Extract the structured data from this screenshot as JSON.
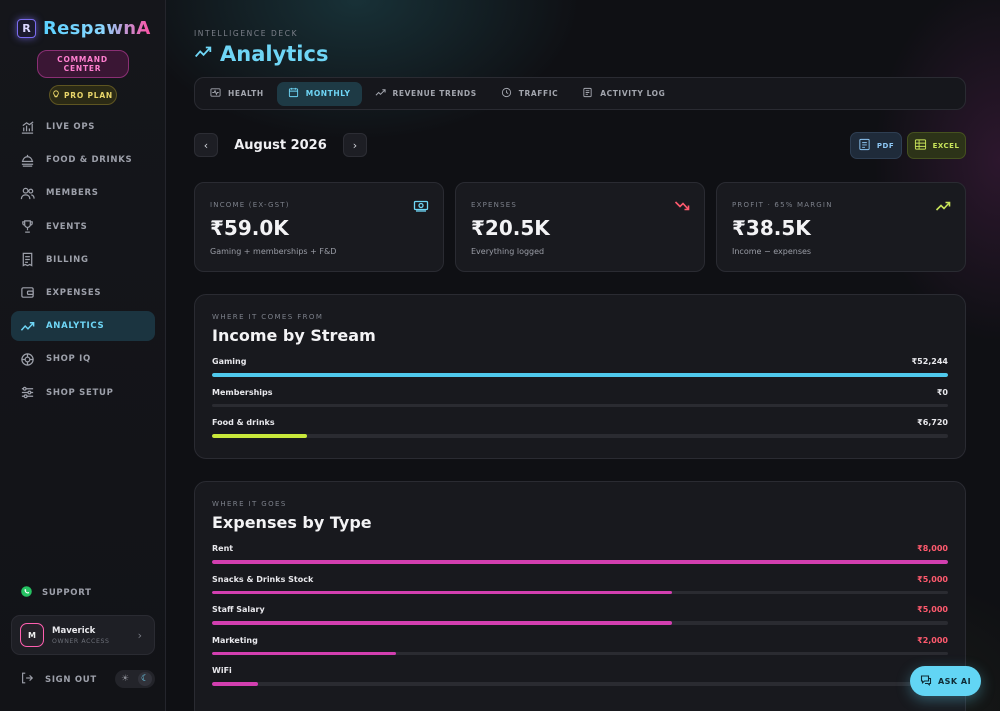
{
  "brand": {
    "logo_letter": "R",
    "name": "RespawnA"
  },
  "badges": {
    "command": "COMMAND CENTER",
    "plan": "PRO PLAN"
  },
  "sidebar": {
    "items": [
      {
        "label": "LIVE OPS",
        "icon": "chart-bars-icon"
      },
      {
        "label": "FOOD & DRINKS",
        "icon": "food-icon"
      },
      {
        "label": "MEMBERS",
        "icon": "users-icon"
      },
      {
        "label": "EVENTS",
        "icon": "trophy-icon"
      },
      {
        "label": "BILLING",
        "icon": "receipt-icon"
      },
      {
        "label": "EXPENSES",
        "icon": "wallet-icon"
      },
      {
        "label": "ANALYTICS",
        "icon": "trend-icon",
        "active": true
      },
      {
        "label": "SHOP IQ",
        "icon": "brain-icon"
      },
      {
        "label": "SHOP SETUP",
        "icon": "sliders-icon"
      }
    ],
    "support": "SUPPORT",
    "user": {
      "initial": "M",
      "name": "Maverick",
      "role": "OWNER ACCESS"
    },
    "signout": "SIGN OUT"
  },
  "header": {
    "eyebrow": "INTELLIGENCE DECK",
    "title": "Analytics"
  },
  "tabs": [
    {
      "label": "HEALTH",
      "icon": "pulse-icon"
    },
    {
      "label": "MONTHLY",
      "icon": "calendar-icon",
      "active": true
    },
    {
      "label": "REVENUE TRENDS",
      "icon": "trend-icon"
    },
    {
      "label": "TRAFFIC",
      "icon": "clock-icon"
    },
    {
      "label": "ACTIVITY LOG",
      "icon": "log-icon"
    }
  ],
  "period": {
    "label": "August 2026"
  },
  "export": {
    "pdf": "PDF",
    "excel": "EXCEL"
  },
  "kpis": [
    {
      "label": "INCOME (EX-GST)",
      "value": "₹59.0K",
      "sub": "Gaming + memberships + F&D",
      "icon": "cash-icon",
      "color": "#6fd6f6"
    },
    {
      "label": "EXPENSES",
      "value": "₹20.5K",
      "sub": "Everything logged",
      "icon": "trend-down-icon",
      "color": "#ff5a6e"
    },
    {
      "label": "PROFIT · 65% MARGIN",
      "value": "₹38.5K",
      "sub": "Income − expenses",
      "icon": "trend-up-icon",
      "color": "#c8e45a"
    }
  ],
  "income": {
    "eyebrow": "WHERE IT COMES FROM",
    "title": "Income by Stream",
    "rows": [
      {
        "label": "Gaming",
        "amount": "₹52,244",
        "fraction": 1.0,
        "color": "#4fc9ec",
        "amount_color": "#e8e8ec"
      },
      {
        "label": "Memberships",
        "amount": "₹0",
        "fraction": 0.0,
        "color": "#4fc9ec",
        "amount_color": "#e8e8ec"
      },
      {
        "label": "Food & drinks",
        "amount": "₹6,720",
        "fraction": 0.129,
        "color": "#c8e83a",
        "amount_color": "#e8e8ec"
      }
    ]
  },
  "expenses": {
    "eyebrow": "WHERE IT GOES",
    "title": "Expenses by Type",
    "rows": [
      {
        "label": "Rent",
        "amount": "₹8,000",
        "fraction": 1.0,
        "color": "#d23fb0",
        "amount_color": "#ff5a6e"
      },
      {
        "label": "Snacks & Drinks Stock",
        "amount": "₹5,000",
        "fraction": 0.625,
        "color": "#d23fb0",
        "amount_color": "#ff5a6e"
      },
      {
        "label": "Staff Salary",
        "amount": "₹5,000",
        "fraction": 0.625,
        "color": "#d23fb0",
        "amount_color": "#ff5a6e"
      },
      {
        "label": "Marketing",
        "amount": "₹2,000",
        "fraction": 0.25,
        "color": "#d23fb0",
        "amount_color": "#ff5a6e"
      },
      {
        "label": "WiFi",
        "amount": "",
        "fraction": 0.0625,
        "color": "#d23fb0",
        "amount_color": "#ff5a6e"
      }
    ]
  },
  "ask_ai": "ASK AI"
}
